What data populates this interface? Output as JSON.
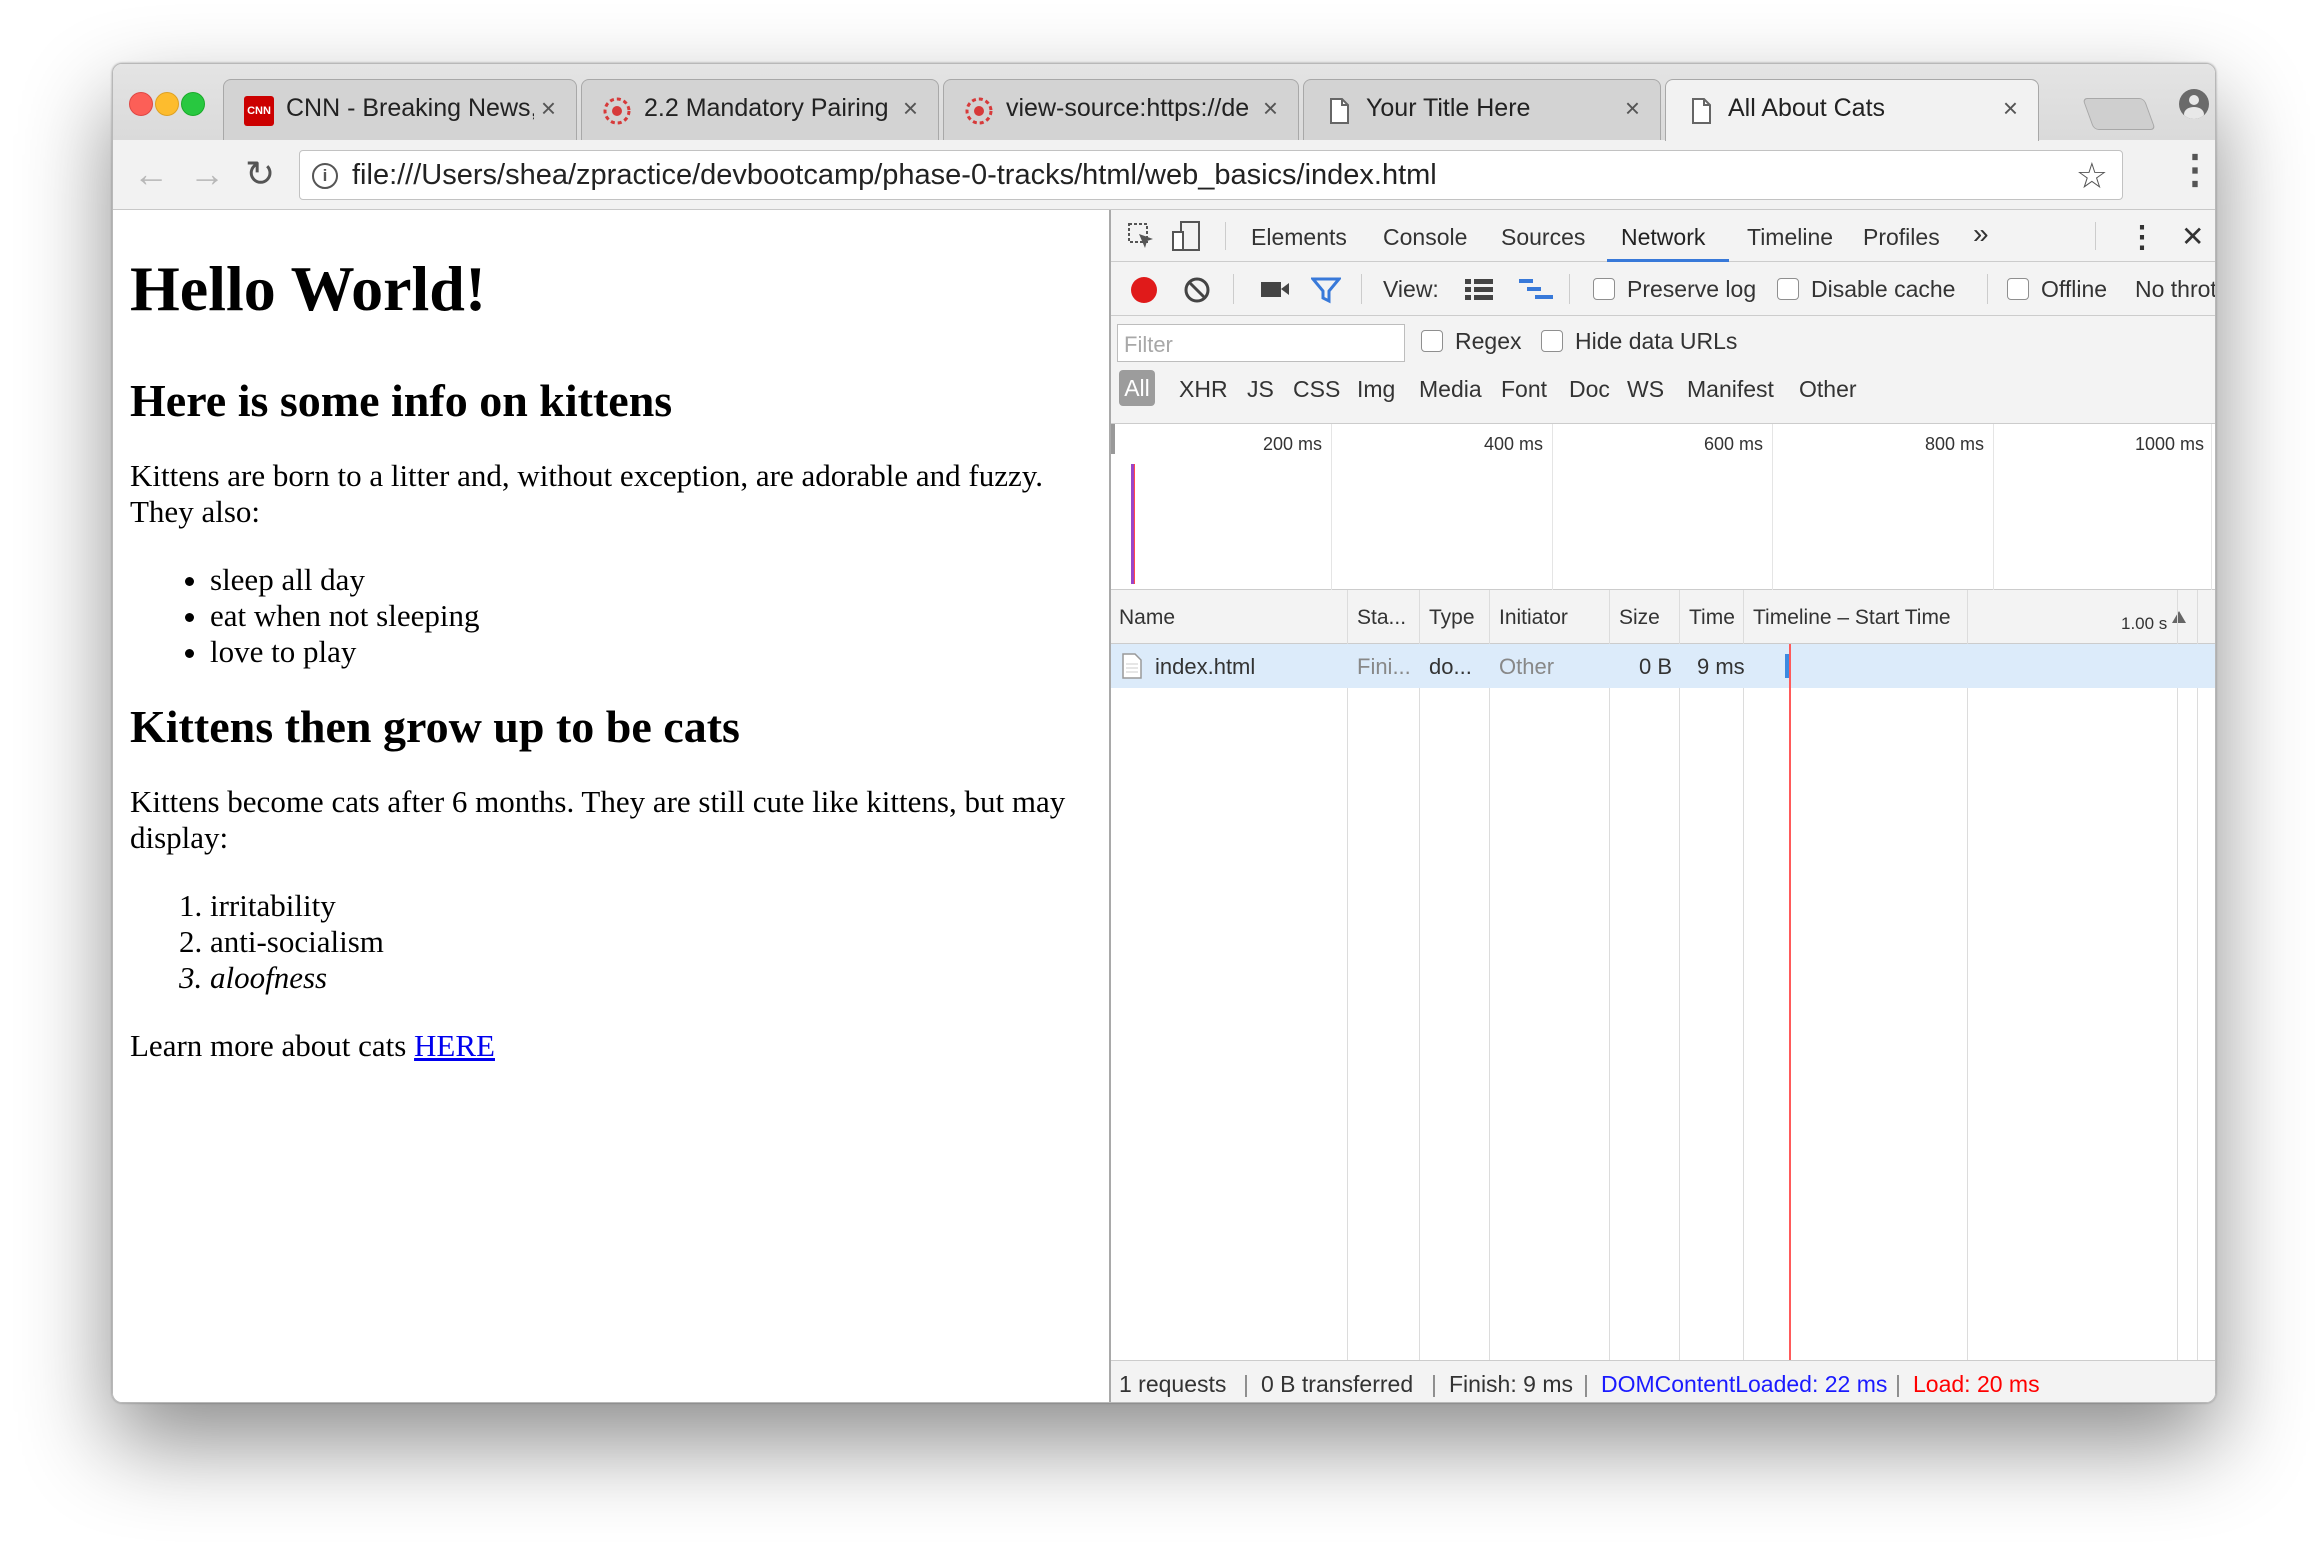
{
  "tabs": [
    {
      "title": "CNN - Breaking News, ",
      "icon": "cnn-logo-icon",
      "close": "×"
    },
    {
      "title": "2.2 Mandatory Pairing",
      "icon": "dbc-logo-icon",
      "close": "×"
    },
    {
      "title": "view-source:https://de",
      "icon": "dbc-logo-icon",
      "close": "×"
    },
    {
      "title": "Your Title Here",
      "icon": "document-icon",
      "close": "×"
    },
    {
      "title": "All About Cats",
      "icon": "document-icon",
      "close": "×"
    }
  ],
  "cnn_badge": "CNN",
  "toolbar": {
    "back": "←",
    "forward": "→",
    "reload": "↻",
    "info": "i",
    "url": "file:///Users/shea/zpractice/devbootcamp/phase-0-tracks/html/web_basics/index.html",
    "star": "☆",
    "menu": "⋮"
  },
  "page": {
    "h1": "Hello World!",
    "h2_kittens": "Here is some info on kittens",
    "p_kittens": "Kittens are born to a litter and, without exception, are adorable and fuzzy. They also:",
    "kitten_list": [
      "sleep all day",
      "eat when not sleeping",
      "love to play"
    ],
    "h2_cats": "Kittens then grow up to be cats",
    "p_cats": "Kittens become cats after 6 months. They are still cute like kittens, but may display:",
    "cat_list": [
      "irritability",
      "anti-socialism",
      "aloofness"
    ],
    "learn_more": "Learn more about cats ",
    "link": "HERE"
  },
  "devtools": {
    "tabs": [
      "Elements",
      "Console",
      "Sources",
      "Network",
      "Timeline",
      "Profiles"
    ],
    "more": "»",
    "menu": "⋮",
    "close": "✕",
    "view_label": "View:",
    "preserve_log": "Preserve log",
    "disable_cache": "Disable cache",
    "offline": "Offline",
    "throttle": "No throttl",
    "filter_placeholder": "Filter",
    "regex": "Regex",
    "hide_data_urls": "Hide data URLs",
    "type_filters": [
      "All",
      "XHR",
      "JS",
      "CSS",
      "Img",
      "Media",
      "Font",
      "Doc",
      "WS",
      "Manifest",
      "Other"
    ],
    "overview_ticks": [
      "200 ms",
      "400 ms",
      "600 ms",
      "800 ms",
      "1000 ms"
    ],
    "columns": [
      "Name",
      "Sta...",
      "Type",
      "Initiator",
      "Size",
      "Time",
      "Timeline – Start Time",
      "1.00 s"
    ],
    "rows": [
      {
        "name": "index.html",
        "status": "Fini...",
        "type": "do...",
        "initiator": "Other",
        "size": "0 B",
        "time": "9 ms"
      }
    ],
    "status": {
      "requests": "1 requests",
      "transferred": "0 B transferred",
      "finish": "Finish: 9 ms",
      "dcl": "DOMContentLoaded: 22 ms",
      "load": "Load: 20 ms",
      "sep": "|"
    },
    "colors": {
      "dcl": "#1a1aff",
      "load": "#ff0000",
      "record": "#e01a1a",
      "accent": "#3879d9"
    }
  }
}
